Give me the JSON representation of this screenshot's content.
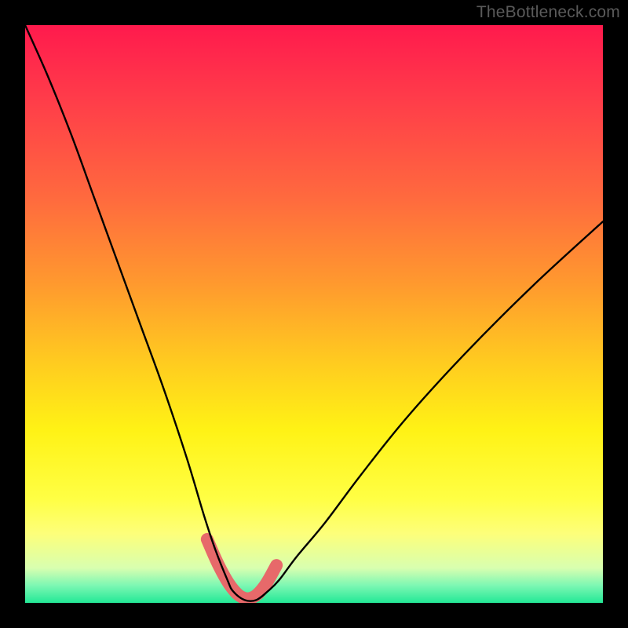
{
  "watermark": "TheBottleneck.com",
  "chart_data": {
    "type": "line",
    "title": "",
    "xlabel": "",
    "ylabel": "",
    "xlim": [
      0,
      100
    ],
    "ylim": [
      0,
      100
    ],
    "note": "Axes are normalized (no tick labels visible). 0,0 = bottom-left of plot area. Curve is a V-shaped black bottleneck curve descending steeply from upper-left, reaching ~0 near x≈38, flat trough x≈36–42, then rising with shallower slope toward upper-right. Trough band is highlighted with thick salmon stroke.",
    "series": [
      {
        "name": "bottleneck-curve",
        "x": [
          0,
          4,
          8,
          12,
          16,
          20,
          24,
          28,
          31,
          33,
          35,
          36,
          38,
          40,
          42,
          44,
          47,
          52,
          58,
          66,
          76,
          88,
          100
        ],
        "y": [
          100,
          91,
          81,
          70,
          59,
          48,
          37,
          25,
          15,
          9,
          4,
          2,
          0.5,
          0.5,
          2,
          4,
          8,
          14,
          22,
          32,
          43,
          55,
          66
        ]
      },
      {
        "name": "trough-highlight",
        "x": [
          31.5,
          33.5,
          35.5,
          37.5,
          39.5,
          41.5,
          43.5
        ],
        "y": [
          11,
          6.5,
          3,
          1,
          1,
          3,
          6.5
        ]
      }
    ],
    "colors": {
      "curve": "#000000",
      "highlight": "#e7696a",
      "gradient_top": "#ff1a4d",
      "gradient_bottom": "#23e896"
    }
  }
}
